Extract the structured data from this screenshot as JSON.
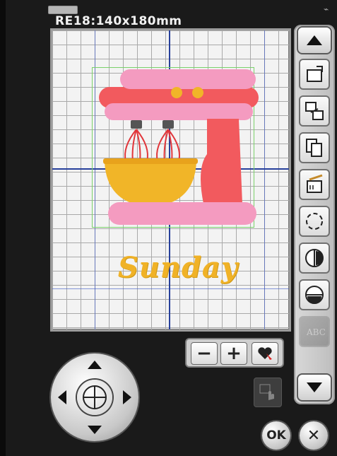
{
  "header": {
    "title": "RE18:140x180mm"
  },
  "design": {
    "text": "Sunday"
  },
  "zoom": {
    "minus_label": "−",
    "plus_label": "+"
  },
  "actions": {
    "ok_label": "OK",
    "cancel_label": "✕"
  },
  "icons": {
    "up_arrow": "up-arrow-icon",
    "down_arrow": "down-arrow-icon",
    "rotate": "rotate-icon",
    "move": "move-icon",
    "copy": "copy-icon",
    "delete": "delete-icon",
    "mirror_h": "mirror-horizontal-icon",
    "mirror_v": "mirror-vertical-icon",
    "border": "border-icon",
    "text": "text-edit-icon",
    "heart": "heart-pointer-icon",
    "hand": "hand-icon"
  },
  "colors": {
    "mixer_pink_light": "#f49bc0",
    "mixer_red": "#f25a5e",
    "accent_yellow": "#f1b528",
    "grid_blue": "#27409b"
  }
}
